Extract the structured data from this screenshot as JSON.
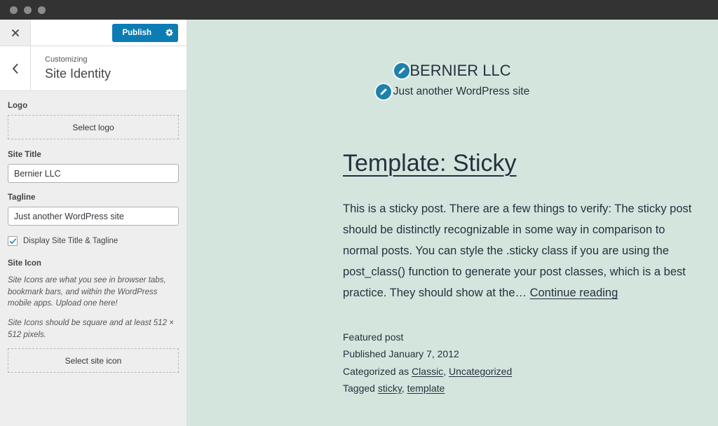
{
  "window": {
    "dots": [
      "close-dot",
      "minimize-dot",
      "maximize-dot"
    ]
  },
  "customizer": {
    "close_label": "✕",
    "publish_label": "Publish",
    "gear_icon": "gear-icon",
    "back_icon": "chevron-left-icon",
    "eyebrow": "Customizing",
    "title": "Site Identity",
    "logo": {
      "label": "Logo",
      "button_label": "Select logo"
    },
    "site_title": {
      "label": "Site Title",
      "value": "Bernier LLC"
    },
    "tagline": {
      "label": "Tagline",
      "value": "Just another WordPress site"
    },
    "display_toggle": {
      "label": "Display Site Title & Tagline",
      "checked": true
    },
    "site_icon": {
      "label": "Site Icon",
      "help_1": "Site Icons are what you see in browser tabs, bookmark bars, and within the WordPress mobile apps. Upload one here!",
      "help_2": "Site Icons should be square and at least 512 × 512 pixels.",
      "button_label": "Select site icon"
    }
  },
  "preview": {
    "background_color": "#d4e5de",
    "accent_color": "#1f81ab",
    "site_title": "BERNIER LLC",
    "site_tagline": "Just another WordPress site",
    "edit_title_icon": "pencil-icon",
    "edit_tagline_icon": "pencil-icon",
    "post": {
      "title": "Template: Sticky",
      "excerpt": "This is a sticky post. There are a few things to verify: The sticky post should be distinctly recognizable in some way in comparison to normal posts. You can style the .sticky class if you are using the post_class() function to generate your post classes, which is a best practice. They should show at the… ",
      "continue_label": "Continue reading",
      "featured_label": "Featured post",
      "published_label": "Published January 7, 2012",
      "categorized_prefix": "Categorized as ",
      "category_1": "Classic",
      "category_separator": ", ",
      "category_2": "Uncategorized",
      "tagged_prefix": "Tagged ",
      "tag_1": "sticky",
      "tag_separator": ", ",
      "tag_2": "template"
    }
  }
}
